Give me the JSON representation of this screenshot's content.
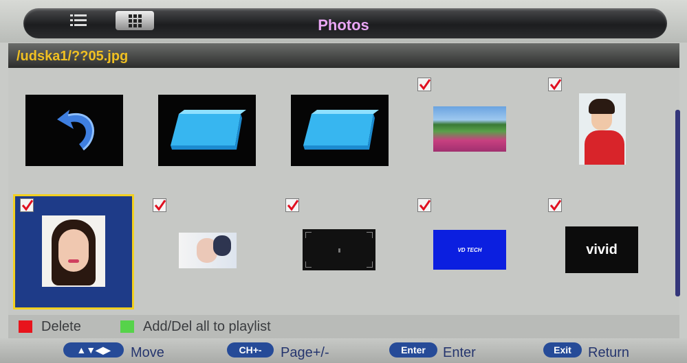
{
  "header": {
    "title": "Photos",
    "list_view_icon": "list-view-icon",
    "grid_view_icon": "grid-view-icon"
  },
  "path": "/udska1/??05.jpg",
  "grid": {
    "items": [
      {
        "type": "back-folder-icon",
        "checked": false
      },
      {
        "type": "folder-icon",
        "checked": false
      },
      {
        "type": "folder-icon",
        "checked": false
      },
      {
        "type": "photo-landscape-flowers",
        "checked": true
      },
      {
        "type": "photo-portrait-woman-red",
        "checked": true
      },
      {
        "type": "photo-portrait-woman",
        "checked": true,
        "selected": true
      },
      {
        "type": "photo-portrait-woman-white",
        "checked": true
      },
      {
        "type": "photo-dark-test-pattern",
        "checked": true
      },
      {
        "type": "photo-vd-tech-logo",
        "checked": true,
        "text": "VD TECH"
      },
      {
        "type": "photo-vivid-logo",
        "checked": true,
        "text": "vivid"
      }
    ]
  },
  "legend": {
    "delete_label": "Delete",
    "delete_color": "#e8141c",
    "playlist_label": "Add/Del all to playlist",
    "playlist_color": "#56d34a"
  },
  "hints": {
    "move_key": "▲▼◀▶",
    "move_label": "Move",
    "page_key": "CH+-",
    "page_label": "Page+/-",
    "enter_key": "Enter",
    "enter_label": "Enter",
    "exit_key": "Exit",
    "exit_label": "Return"
  }
}
